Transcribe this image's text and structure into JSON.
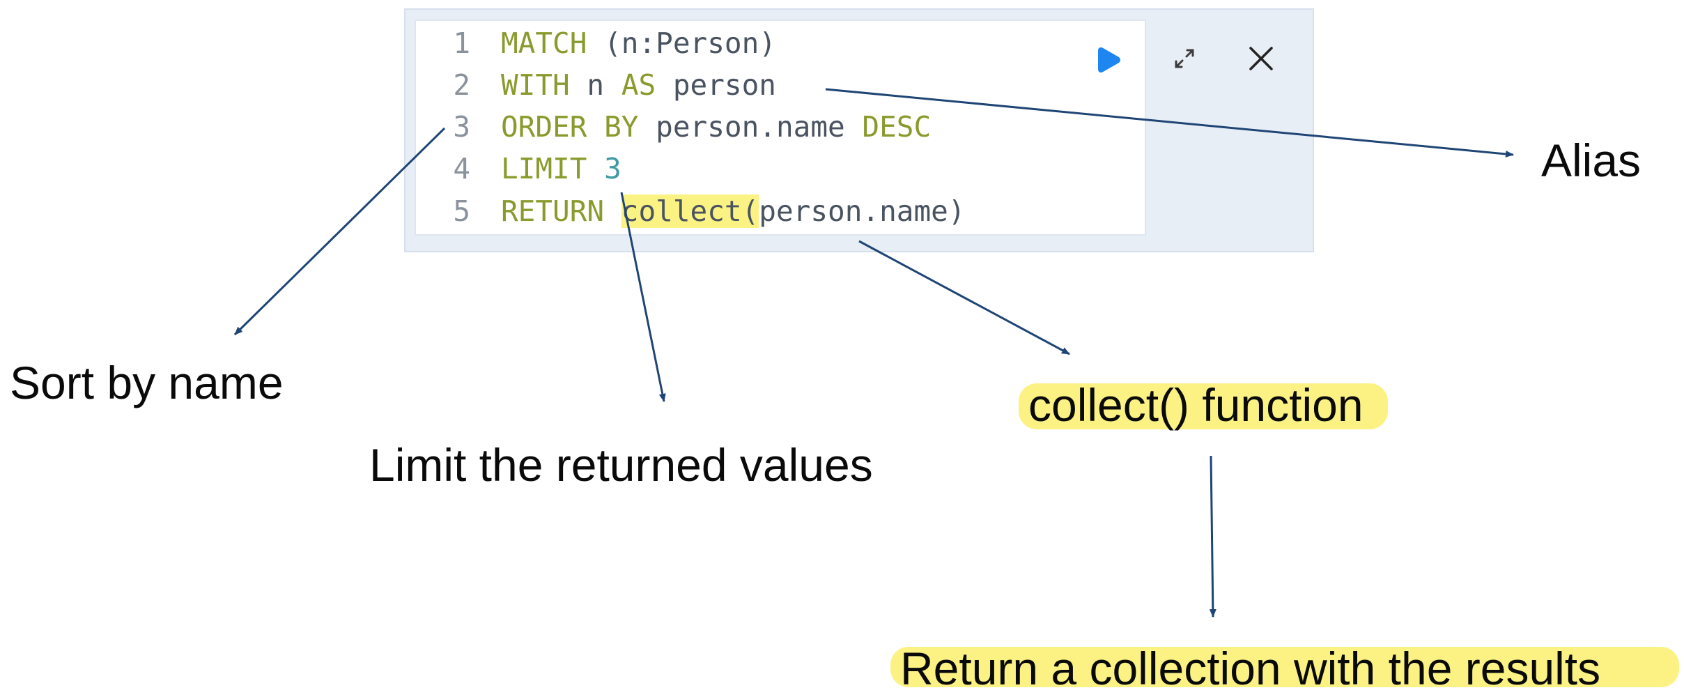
{
  "editor": {
    "lines": [
      {
        "num": "1",
        "tokens": [
          {
            "text": "MATCH",
            "cls": "kw"
          },
          {
            "text": " (n:Person)",
            "cls": "id"
          }
        ]
      },
      {
        "num": "2",
        "tokens": [
          {
            "text": "WITH",
            "cls": "kw"
          },
          {
            "text": " n ",
            "cls": "id"
          },
          {
            "text": "AS",
            "cls": "kw"
          },
          {
            "text": " person",
            "cls": "id"
          }
        ]
      },
      {
        "num": "3",
        "tokens": [
          {
            "text": "ORDER BY",
            "cls": "kw"
          },
          {
            "text": " person.name ",
            "cls": "id"
          },
          {
            "text": "DESC",
            "cls": "kw"
          }
        ]
      },
      {
        "num": "4",
        "tokens": [
          {
            "text": "LIMIT",
            "cls": "kw"
          },
          {
            "text": " ",
            "cls": "id"
          },
          {
            "text": "3",
            "cls": "num"
          }
        ]
      },
      {
        "num": "5",
        "tokens": [
          {
            "text": "RETURN",
            "cls": "kw"
          },
          {
            "text": " ",
            "cls": "id"
          },
          {
            "text": "collect(",
            "cls": "id hl"
          },
          {
            "text": "person.name)",
            "cls": "id"
          }
        ]
      }
    ],
    "controls": {
      "run_icon": "play-icon",
      "expand_icon": "expand-icon",
      "close_icon": "close-icon",
      "run_color": "#1d86f0"
    }
  },
  "annotations": {
    "alias": "Alias",
    "sort": "Sort by name",
    "limit": "Limit the returned values",
    "collect": "collect() function",
    "result": "Return a collection with the results"
  },
  "colors": {
    "arrow": "#1f4575",
    "highlight": "#fbf283"
  }
}
